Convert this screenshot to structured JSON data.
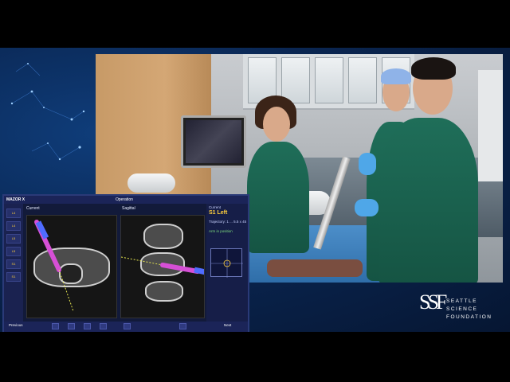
{
  "nav_screen": {
    "brand": "MAZOR X",
    "top_left_text": "Current",
    "top_center": "Operation",
    "view_left": "Current",
    "view_right": "Sagittal",
    "side_levels": [
      "L4",
      "L4",
      "L5",
      "L5",
      "S1",
      "S1"
    ],
    "panel": {
      "header": "Current",
      "level": "S1 Left",
      "line1": "Trajectory: 1 ... 5.5 x 45",
      "status": "Arm in position"
    },
    "bottom_left": "Previous",
    "bottom_right": "Next"
  },
  "logo": {
    "mark": "SSF",
    "line1": "SEATTLE",
    "line2": "SCIENCE",
    "line3": "FOUNDATION"
  },
  "colors": {
    "background": "#0a2652",
    "nav_bg": "#121a3a",
    "trajectory": "#d64fd6",
    "accent": "#ffcf3d"
  }
}
